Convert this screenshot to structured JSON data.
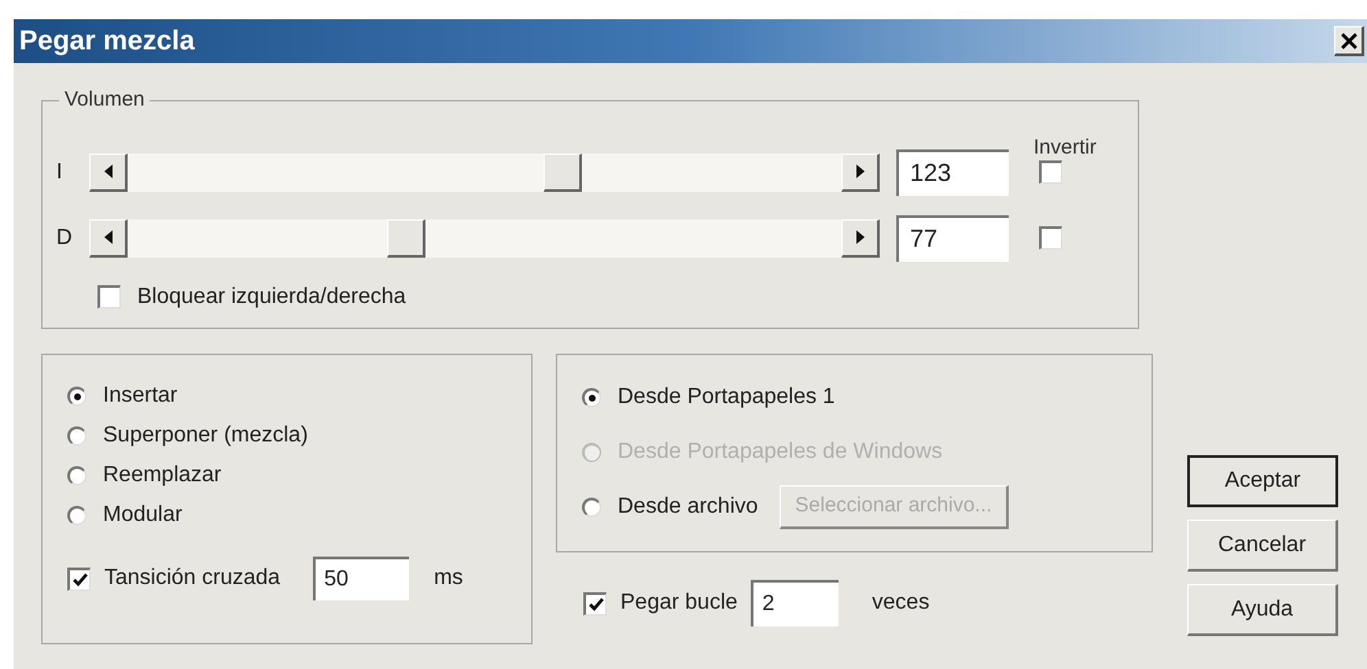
{
  "window": {
    "title": "Pegar mezcla"
  },
  "volume": {
    "title": "Volumen",
    "invert_header": "Invertir",
    "channels": [
      {
        "label": "I",
        "level": 0.615,
        "value": "123",
        "inverted": false
      },
      {
        "label": "D",
        "level": 0.385,
        "value": "77",
        "inverted": false
      }
    ],
    "lock": {
      "label": "Bloquear izquierda/derecha",
      "checked": false
    }
  },
  "mode": {
    "options": [
      {
        "label": "Insertar",
        "selected": true
      },
      {
        "label": "Superponer (mezcla)",
        "selected": false
      },
      {
        "label": "Reemplazar",
        "selected": false
      },
      {
        "label": "Modular",
        "selected": false
      }
    ],
    "crossfade": {
      "label": "Tansición cruzada",
      "checked": true,
      "value": "50",
      "unit": "ms"
    }
  },
  "source": {
    "options": [
      {
        "label": "Desde Portapapeles 1",
        "selected": true,
        "disabled": false
      },
      {
        "label": "Desde Portapapeles de Windows",
        "selected": false,
        "disabled": true
      },
      {
        "label": "Desde archivo",
        "selected": false,
        "disabled": false
      }
    ],
    "file_button": {
      "label": "Seleccionar archivo...",
      "disabled": true
    }
  },
  "loop": {
    "label": "Pegar bucle",
    "checked": true,
    "value": "2",
    "unit": "veces"
  },
  "buttons": [
    {
      "label": "Aceptar",
      "default": true
    },
    {
      "label": "Cancelar",
      "default": false
    },
    {
      "label": "Ayuda",
      "default": false
    }
  ]
}
